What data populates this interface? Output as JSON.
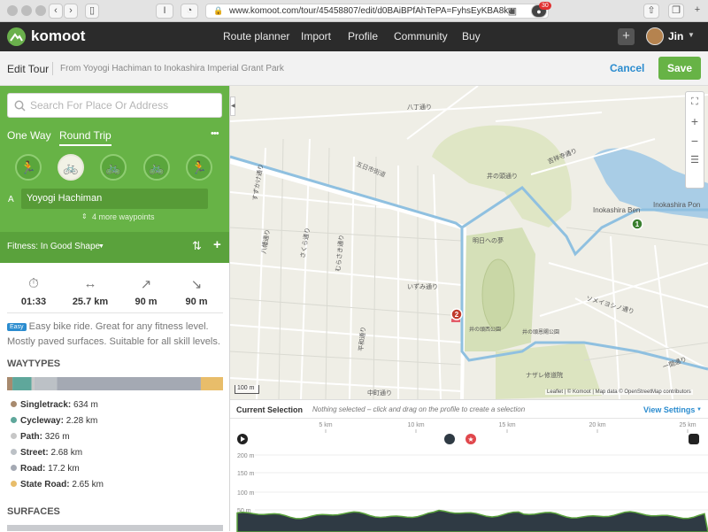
{
  "browser": {
    "url": "www.komoot.com/tour/45458807/edit/d0BAiBPfAhTePA=FyhsEyKBA8kw",
    "reader_label": "I",
    "badge_count": "30"
  },
  "nav": {
    "brand": "komoot",
    "links": [
      "Route planner",
      "Import",
      "Profile",
      "Community",
      "Buy"
    ],
    "user": "Jin"
  },
  "editbar": {
    "title": "Edit Tour",
    "subtitle": "From Yoyogi Hachiman to Inokashira Imperial Grant Park",
    "cancel": "Cancel",
    "save": "Save"
  },
  "planner": {
    "search_placeholder": "Search For Place Or Address",
    "modes": [
      "One Way",
      "Round Trip"
    ],
    "more": "•••",
    "sports": [
      "hiking",
      "touring bike",
      "road bike",
      "mountain bike",
      "running"
    ],
    "waypoint_letter": "A",
    "waypoint": "Yoyogi Hachiman",
    "more_waypoints": "4 more waypoints",
    "fitness": "Fitness: In Good Shape",
    "stats": [
      {
        "icon": "duration",
        "value": "01:33"
      },
      {
        "icon": "distance",
        "value": "25.7 km"
      },
      {
        "icon": "uphill",
        "value": "90 m"
      },
      {
        "icon": "downhill",
        "value": "90 m"
      }
    ],
    "difficulty_badge": "Easy",
    "difficulty_text": "Easy bike ride. Great for any fitness level. Mostly paved surfaces. Suitable for all skill levels.",
    "waytypes_heading": "WAYTYPES",
    "waytypes": [
      {
        "label": "Singletrack:",
        "value": "634 m",
        "color": "#a88a6e",
        "share": 0.025
      },
      {
        "label": "Cycleway:",
        "value": "2.28 km",
        "color": "#5fa79b",
        "share": 0.089
      },
      {
        "label": "Path:",
        "value": "326 m",
        "color": "#c7c7c7",
        "share": 0.013
      },
      {
        "label": "Street:",
        "value": "2.68 km",
        "color": "#bcc1c6",
        "share": 0.104
      },
      {
        "label": "Road:",
        "value": "17.2 km",
        "color": "#a4a9b3",
        "share": 0.669
      },
      {
        "label": "State Road:",
        "value": "2.65 km",
        "color": "#e8bd6a",
        "share": 0.103
      }
    ],
    "surfaces_heading": "SURFACES"
  },
  "map": {
    "labels": [
      "八丁通り",
      "五日市街道",
      "吉祥寺通り",
      "明日への夢",
      "Inokashira Ben",
      "Inokashira Pon",
      "いずみ通り",
      "中町通り",
      "すずかけ通り",
      "むらさき通り",
      "さくら通り",
      "井の頭西公園",
      "井の頭恩賜公園",
      "ナザレ修道院",
      "ソメイヨシノ通り",
      "井の頭通り",
      "一間通り",
      "八幡通り",
      "平和通り"
    ],
    "scale": "100 m",
    "attribution": "Leaflet | © Komoot | Map data © OpenStreetMap contributors",
    "waypoint_number": "2",
    "waypoint_number_b": "1"
  },
  "profile": {
    "title": "Current Selection",
    "hint": "Nothing selected – click and drag on the profile to create a selection",
    "settings": "View Settings",
    "x_ticks": [
      "5 km",
      "10 km",
      "15 km",
      "20 km",
      "25 km"
    ],
    "y_ticks": [
      "200 m",
      "150 m",
      "100 m",
      "50 m"
    ]
  }
}
